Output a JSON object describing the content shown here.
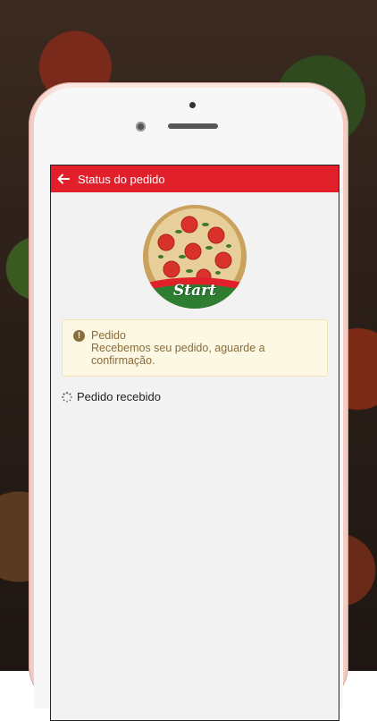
{
  "appbar": {
    "title": "Status do pedido"
  },
  "logo": {
    "text": "Start"
  },
  "alert": {
    "title": "Pedido",
    "message": "Recebemos seu pedido, aguarde a confirmação."
  },
  "status": {
    "label": "Pedido recebido"
  },
  "colors": {
    "appbar": "#e1202b",
    "alert_bg": "#fcf8e3",
    "alert_text": "#8a6d3b"
  }
}
